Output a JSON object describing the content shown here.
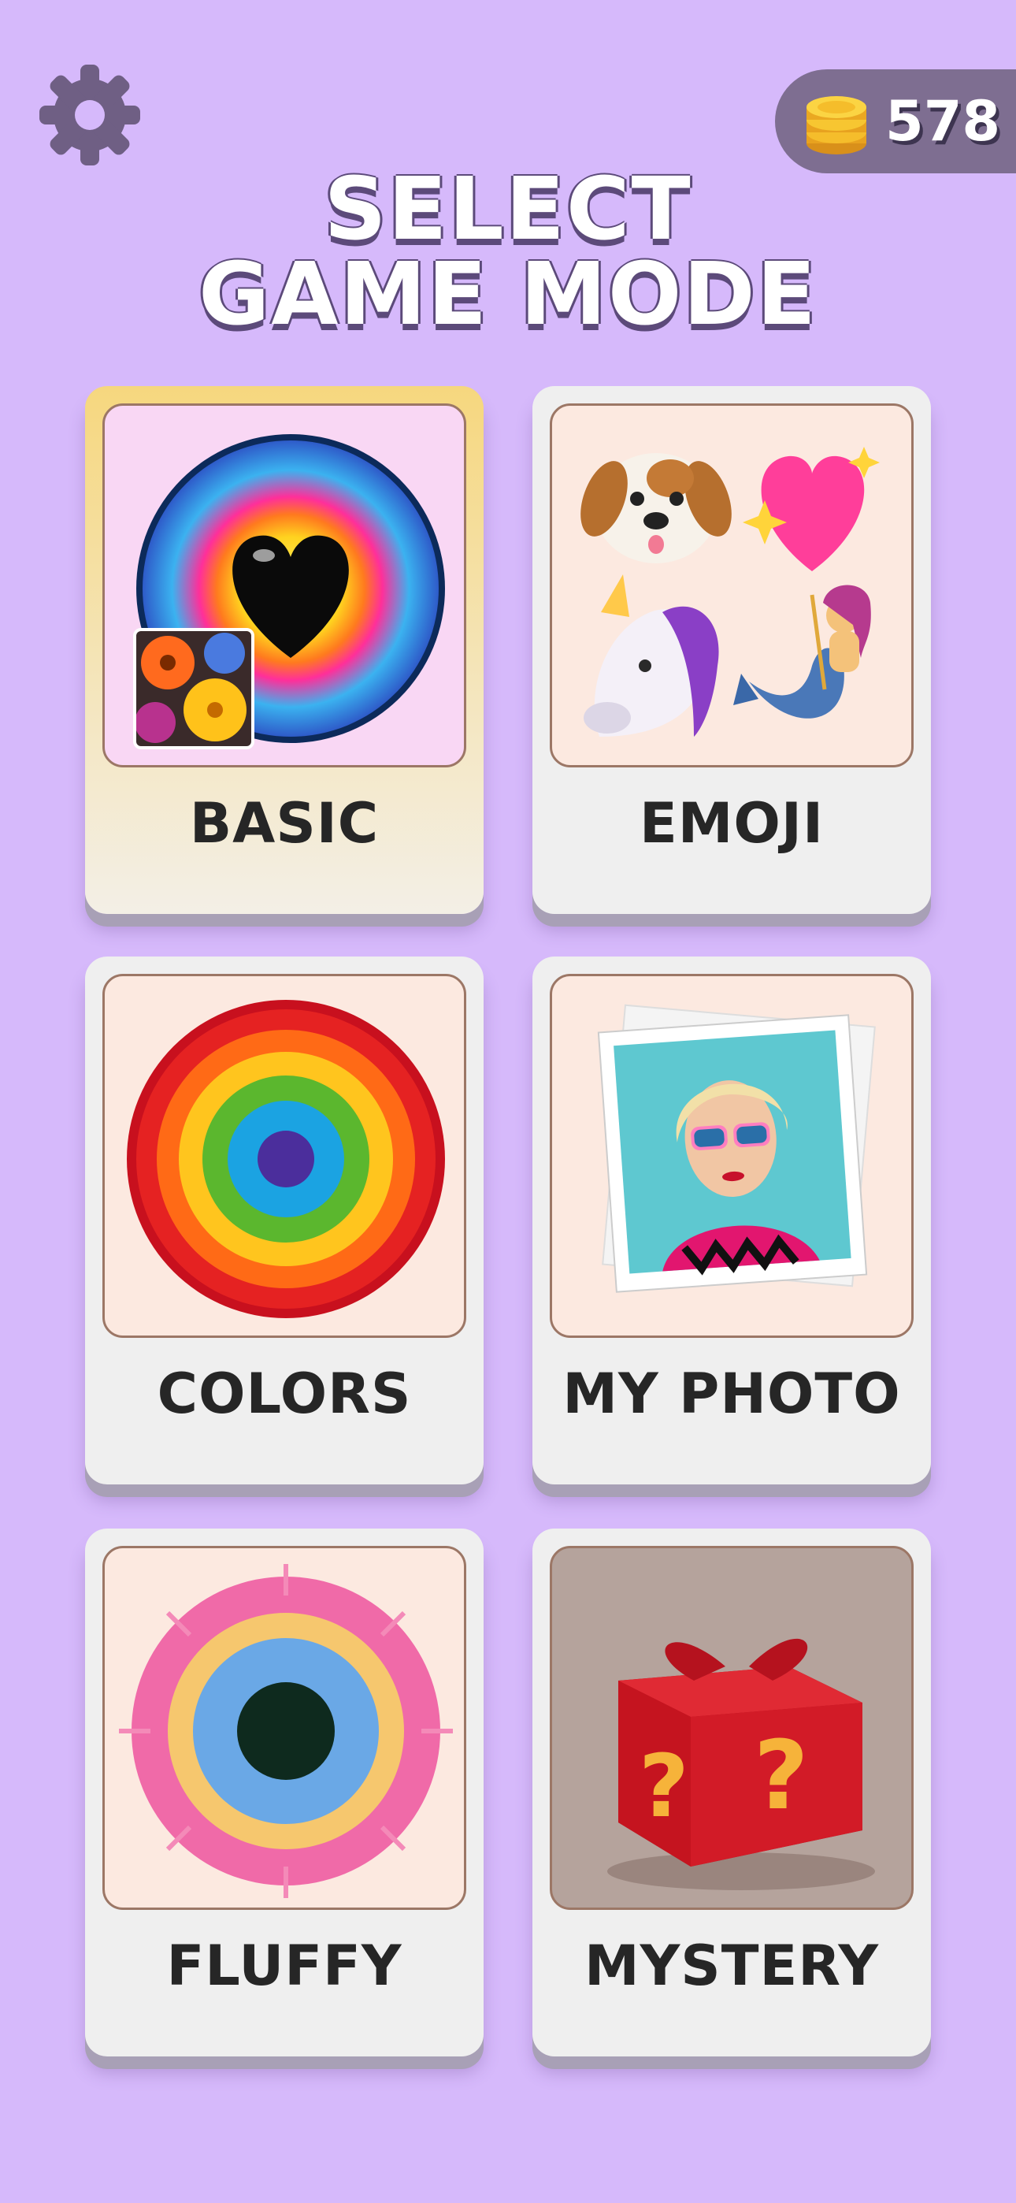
{
  "header": {
    "coins": "578",
    "title_line1": "SELECT",
    "title_line2": "GAME MODE"
  },
  "modes": [
    {
      "label": "BASIC",
      "selected": true
    },
    {
      "label": "EMOJI",
      "selected": false
    },
    {
      "label": "COLORS",
      "selected": false
    },
    {
      "label": "MY PHOTO",
      "selected": false
    },
    {
      "label": "FLUFFY",
      "selected": false
    },
    {
      "label": "MYSTERY",
      "selected": false
    }
  ],
  "colors": {
    "background": "#d6b9fb",
    "card": "#efefef",
    "selected_card": "#f6d77e",
    "coin_pill": "#7e6e91"
  },
  "icons": [
    "gear-icon",
    "coin-stack-icon",
    "heart-icon",
    "flower-thumbnail",
    "dog-emoji-icon",
    "sparkling-heart-emoji-icon",
    "unicorn-emoji-icon",
    "mermaid-emoji-icon",
    "rainbow-target-icon",
    "photo-stack-icon",
    "fluffy-ring-icon",
    "mystery-gift-icon"
  ]
}
